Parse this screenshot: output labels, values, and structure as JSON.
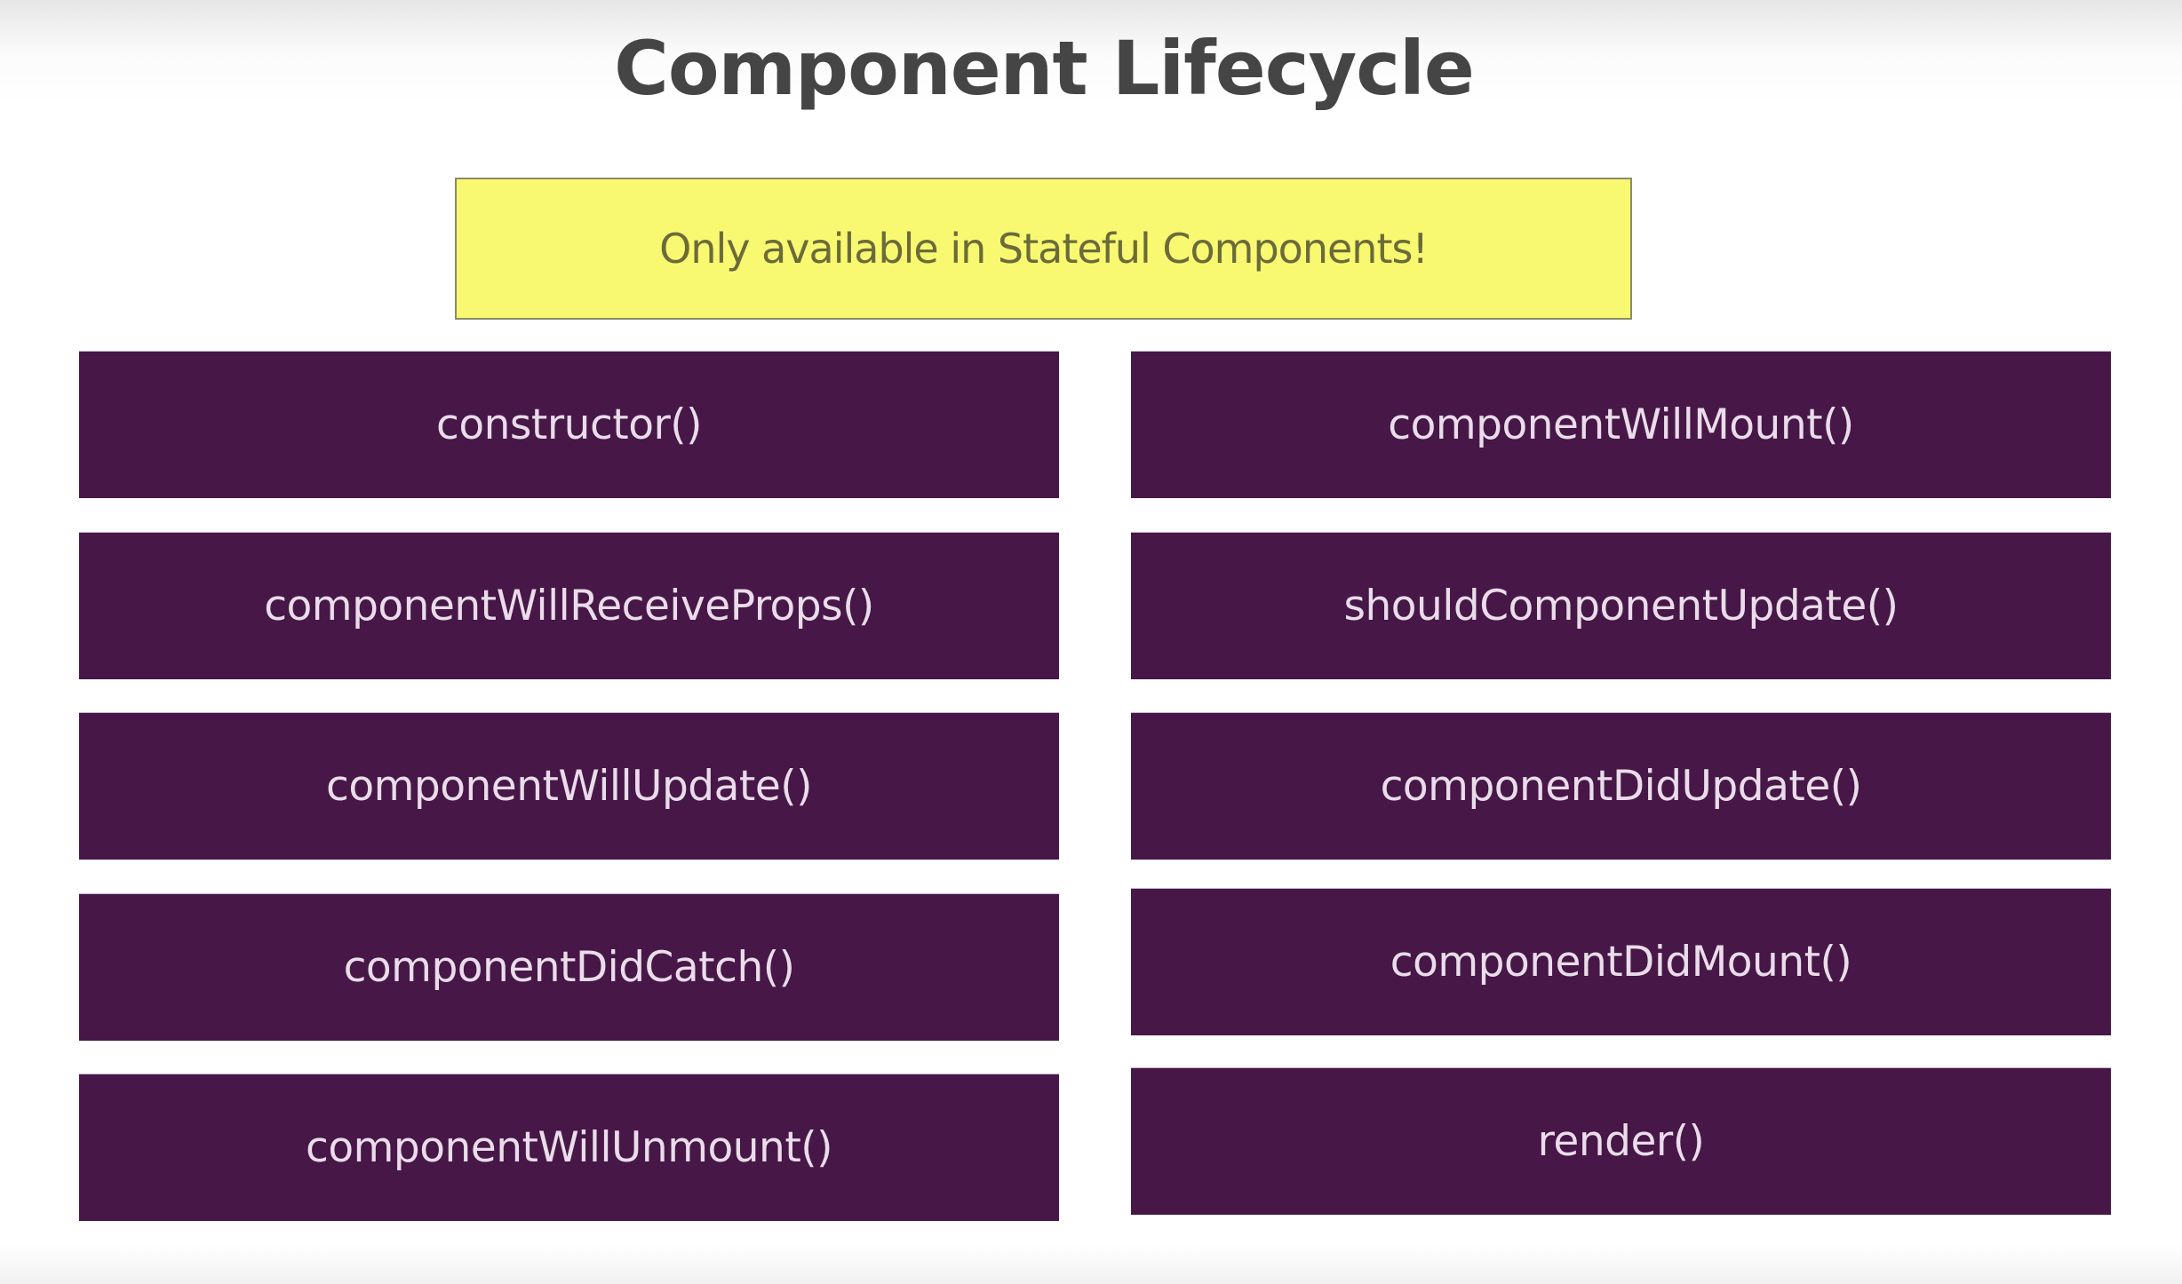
{
  "title": "Component Lifecycle",
  "note": "Only available in Stateful Components!",
  "colors": {
    "box": "#461747",
    "note": "#f9f871",
    "title": "#454545"
  },
  "left_methods": [
    "constructor()",
    "componentWillReceiveProps()",
    "componentWillUpdate()",
    "componentDidCatch()",
    "componentWillUnmount()"
  ],
  "right_methods": [
    "componentWillMount()",
    "shouldComponentUpdate()",
    "componentDidUpdate()",
    "componentDidMount()",
    "render()"
  ]
}
